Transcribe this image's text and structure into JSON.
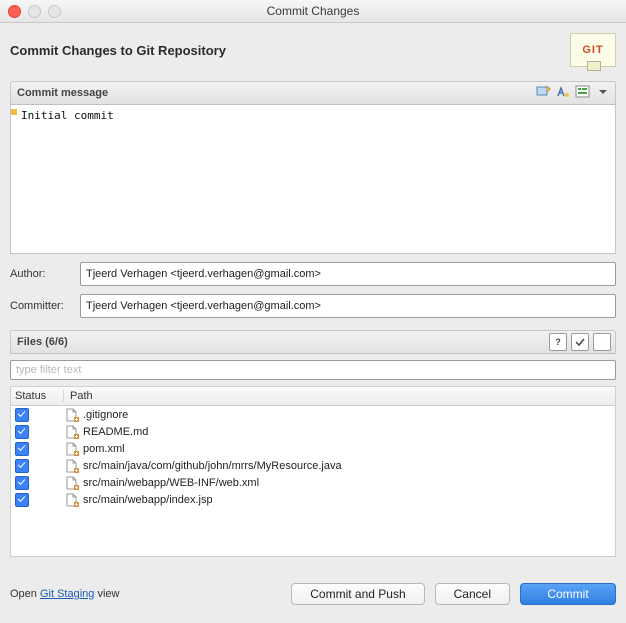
{
  "window": {
    "title": "Commit Changes"
  },
  "header": {
    "title": "Commit Changes to Git Repository",
    "logo_text": "GIT"
  },
  "commit_section": {
    "title": "Commit message",
    "message": "Initial commit"
  },
  "author": {
    "label": "Author:",
    "value": "Tjeerd Verhagen <tjeerd.verhagen@gmail.com>"
  },
  "committer": {
    "label": "Committer:",
    "value": "Tjeerd Verhagen <tjeerd.verhagen@gmail.com>"
  },
  "files_section": {
    "title": "Files (6/6)",
    "filter_placeholder": "type filter text",
    "columns": {
      "status": "Status",
      "path": "Path"
    },
    "rows": [
      {
        "checked": true,
        "icon": "file-icon",
        "path": ".gitignore"
      },
      {
        "checked": true,
        "icon": "file-icon",
        "path": "README.md"
      },
      {
        "checked": true,
        "icon": "file-icon",
        "path": "pom.xml"
      },
      {
        "checked": true,
        "icon": "file-icon",
        "path": "src/main/java/com/github/john/mrrs/MyResource.java"
      },
      {
        "checked": true,
        "icon": "file-icon",
        "path": "src/main/webapp/WEB-INF/web.xml"
      },
      {
        "checked": true,
        "icon": "file-icon",
        "path": "src/main/webapp/index.jsp"
      }
    ]
  },
  "footer": {
    "open_text_pre": "Open ",
    "open_link": "Git Staging",
    "open_text_post": " view",
    "commit_and_push": "Commit and Push",
    "cancel": "Cancel",
    "commit": "Commit"
  }
}
